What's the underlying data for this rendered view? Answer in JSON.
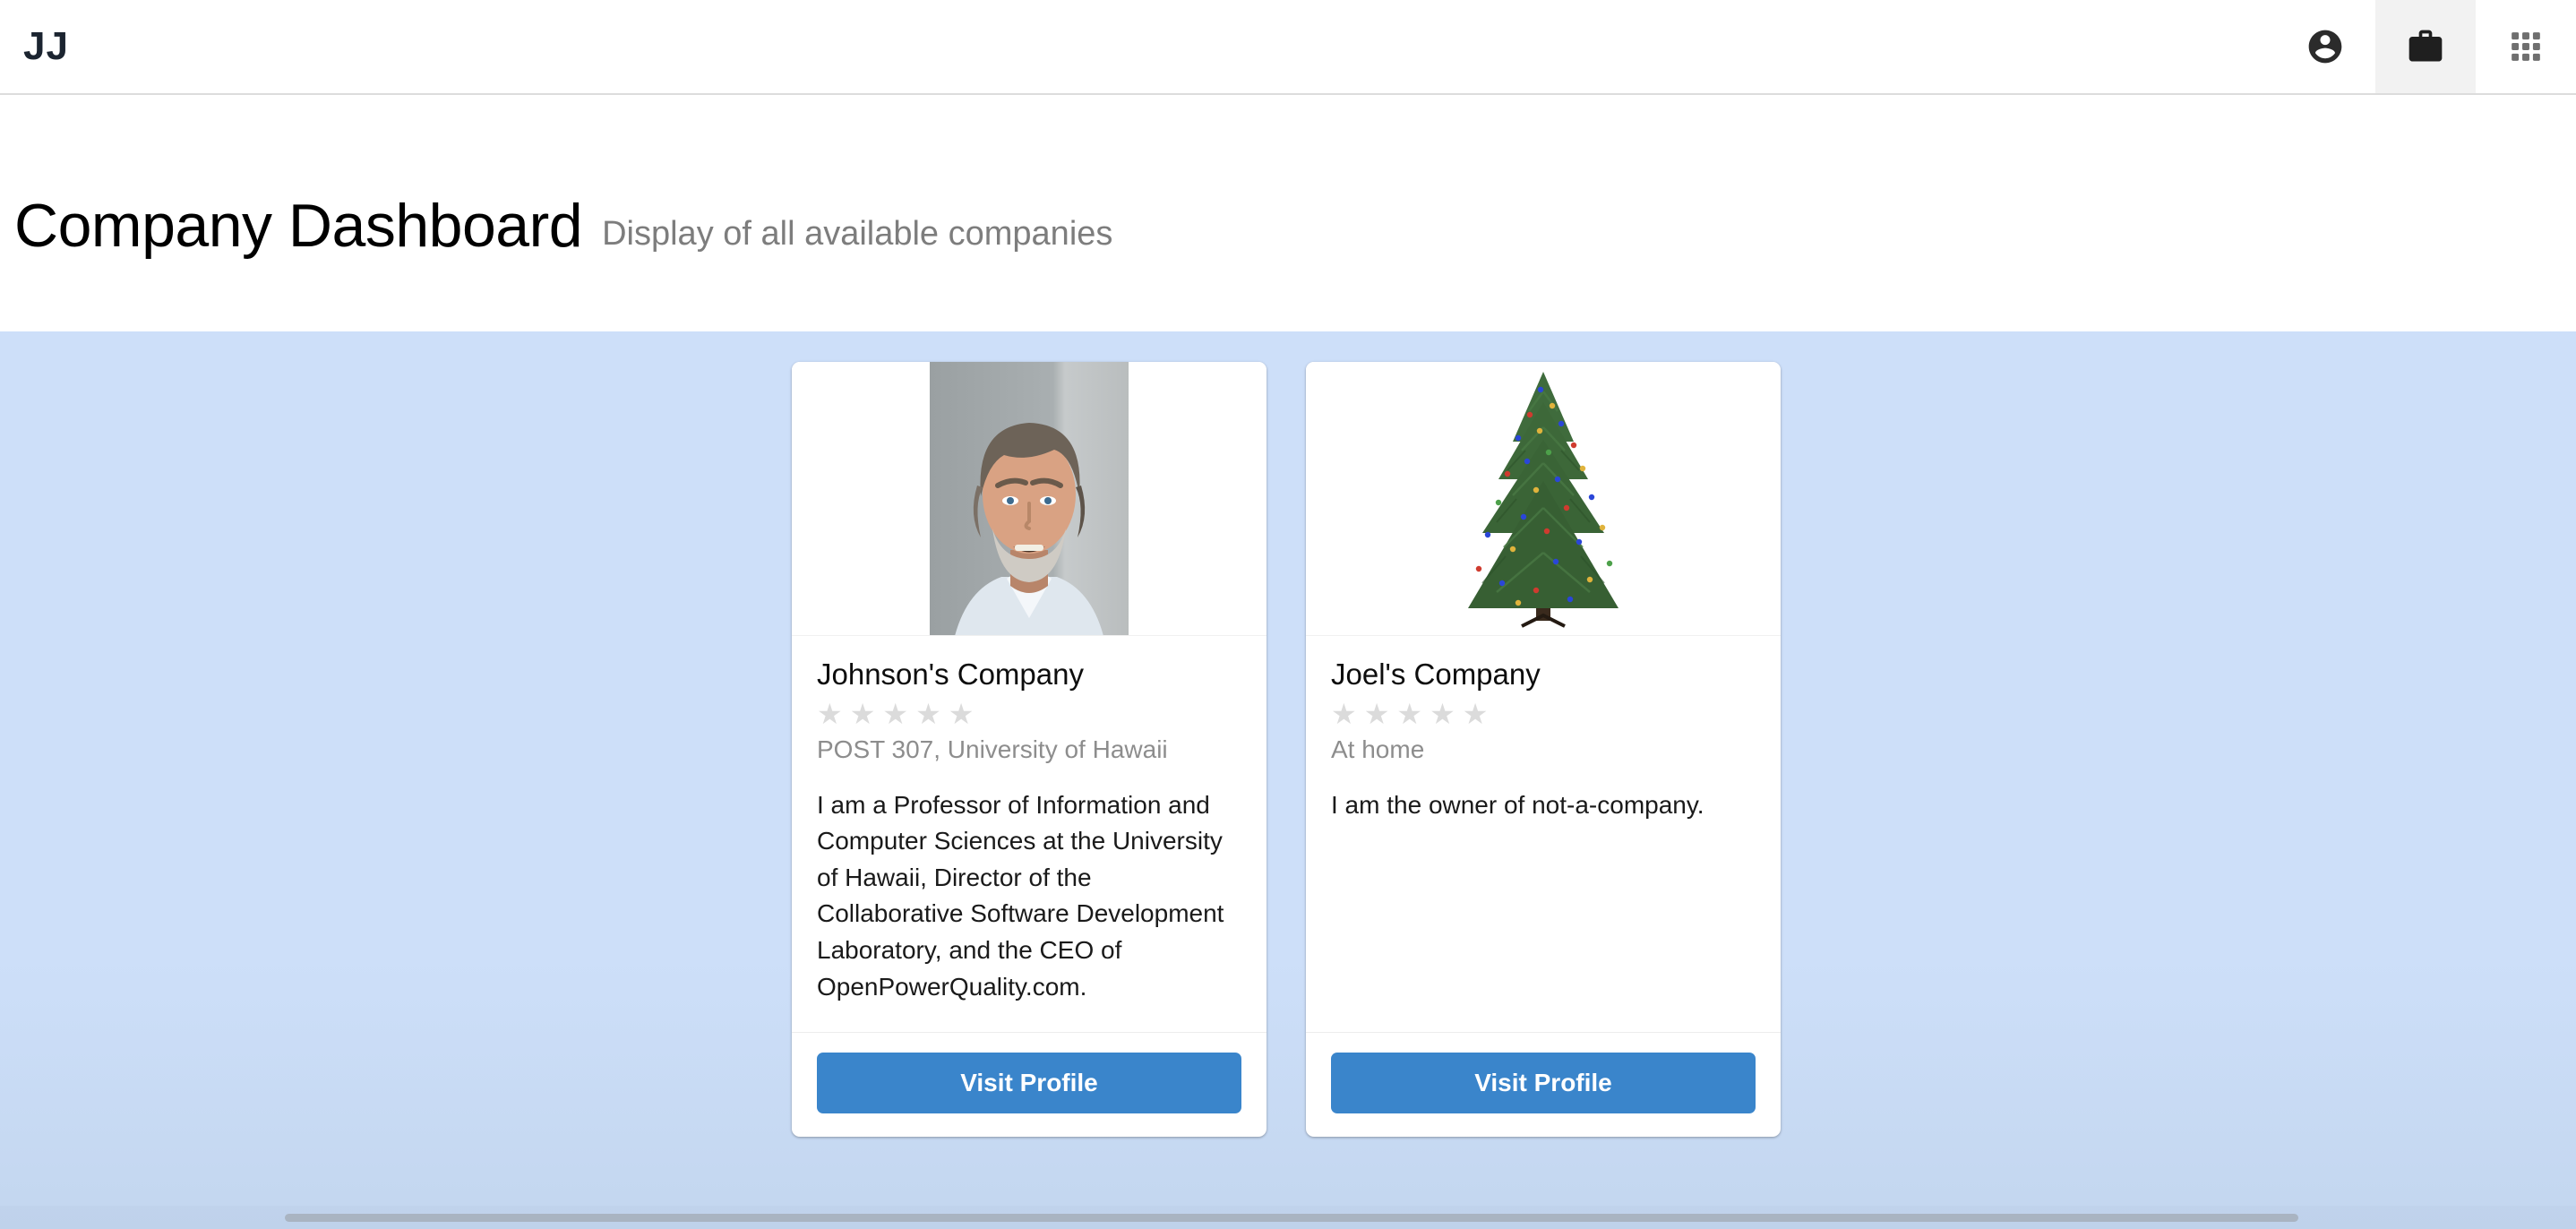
{
  "navbar": {
    "brand": "JJ",
    "actions": [
      {
        "name": "account-circle-icon",
        "label": "Account"
      },
      {
        "name": "briefcase-icon",
        "label": "Companies",
        "active": true
      },
      {
        "name": "apps-grid-icon",
        "label": "Apps"
      }
    ]
  },
  "header": {
    "title": "Company Dashboard",
    "subtitle": "Display of all available companies"
  },
  "cards": [
    {
      "image_alt": "portrait-photo",
      "title": "Johnson's Company",
      "rating": 0,
      "stars_total": 5,
      "location": "POST 307, University of Hawaii",
      "description": "I am a Professor of Information and Computer Sciences at the University of Hawaii, Director of the Collaborative Software Development Laboratory, and the CEO of OpenPowerQuality.com.",
      "button_label": "Visit Profile"
    },
    {
      "image_alt": "christmas-tree-photo",
      "title": "Joel's Company",
      "rating": 0,
      "stars_total": 5,
      "location": "At home",
      "description": "I am the owner of not-a-company.",
      "button_label": "Visit Profile"
    }
  ],
  "colors": {
    "accent_blue": "#3a85cb",
    "page_background": "#cddff9",
    "star_empty": "#dbdbdb",
    "muted_text": "#8d8d8d"
  }
}
